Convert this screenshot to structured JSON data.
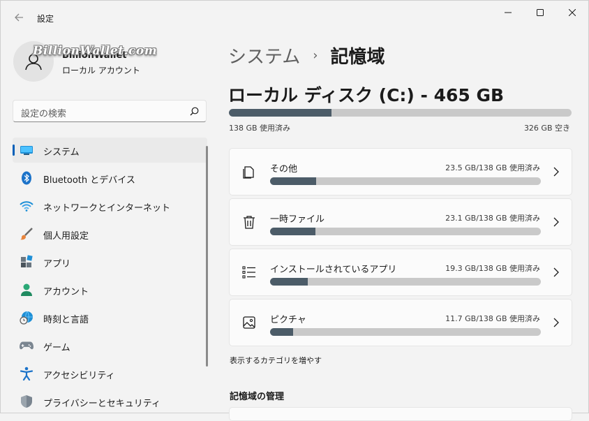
{
  "titlebar": {
    "title": "設定"
  },
  "profile": {
    "name": "BillionWallet",
    "watermark": "BillionWallet.com",
    "account_type": "ローカル アカウント"
  },
  "search": {
    "placeholder": "設定の検索"
  },
  "nav": {
    "items": [
      {
        "label": "システム",
        "icon": "system-display-icon",
        "active": true
      },
      {
        "label": "Bluetooth とデバイス",
        "icon": "bluetooth-icon"
      },
      {
        "label": "ネットワークとインターネット",
        "icon": "wifi-icon"
      },
      {
        "label": "個人用設定",
        "icon": "paintbrush-icon"
      },
      {
        "label": "アプリ",
        "icon": "apps-icon"
      },
      {
        "label": "アカウント",
        "icon": "account-icon"
      },
      {
        "label": "時刻と言語",
        "icon": "globe-clock-icon"
      },
      {
        "label": "ゲーム",
        "icon": "gamepad-icon"
      },
      {
        "label": "アクセシビリティ",
        "icon": "accessibility-icon"
      },
      {
        "label": "プライバシーとセキュリティ",
        "icon": "shield-icon"
      }
    ]
  },
  "breadcrumb": {
    "parent": "システム",
    "separator": "›",
    "current": "記憶域"
  },
  "disk": {
    "title": "ローカル ディスク (C:) - 465 GB",
    "used_label": "138 GB 使用済み",
    "free_label": "326 GB 空き",
    "used_fraction": 0.3
  },
  "categories": [
    {
      "name": "その他",
      "usage": "23.5 GB/138 GB 使用済み",
      "fraction": 0.17,
      "icon": "document-icon"
    },
    {
      "name": "一時ファイル",
      "usage": "23.1 GB/138 GB 使用済み",
      "fraction": 0.167,
      "icon": "trash-icon"
    },
    {
      "name": "インストールされているアプリ",
      "usage": "19.3 GB/138 GB 使用済み",
      "fraction": 0.14,
      "icon": "list-icon"
    },
    {
      "name": "ピクチャ",
      "usage": "11.7 GB/138 GB 使用済み",
      "fraction": 0.085,
      "icon": "picture-icon"
    }
  ],
  "more_categories": "表示するカテゴリを増やす",
  "management_section": {
    "title": "記憶域の管理"
  },
  "colors": {
    "accent": "#005fb8",
    "bar_fill": "#4c5c68",
    "bar_track": "#c9c9c9"
  }
}
